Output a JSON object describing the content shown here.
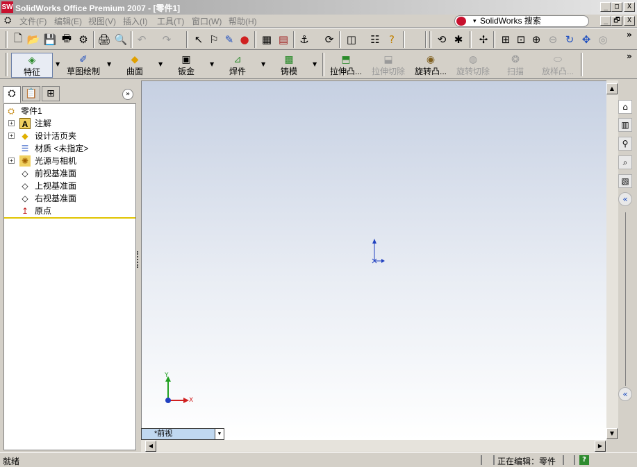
{
  "app": {
    "title": "SolidWorks Office Premium 2007 - [零件1]",
    "logo_text": "SW",
    "accent": "#c8102e"
  },
  "window_buttons": [
    "_",
    "□",
    "X"
  ],
  "doc_buttons": [
    "_",
    "🗗",
    "X"
  ],
  "menu": [
    "文件(F)",
    "编辑(E)",
    "视图(V)",
    "插入(I)",
    "工具(T)",
    "窗口(W)",
    "帮助(H)"
  ],
  "search": {
    "label": "SolidWorks 搜索",
    "dropdown": "▾"
  },
  "toolbar1": {
    "icons": [
      "new-icon",
      "open-icon",
      "save-icon",
      "print-preview-icon",
      "options-icon",
      "print-icon",
      "preview-icon",
      "undo-icon",
      "redo-icon",
      "select-icon",
      "select-other-icon",
      "sketch-icon",
      "traffic-light-icon",
      "grid-icon",
      "brick-icon",
      "instant-icon",
      "rebuild-icon",
      "display-icon",
      "properties-icon",
      "help-icon",
      "rotate-icon",
      "snap-icon",
      "pan-icon",
      "zoom-fit-icon",
      "zoom-area-icon",
      "zoom-in-icon",
      "zoom-out-icon",
      "rotate-view-icon",
      "move-view-icon",
      "roll-icon"
    ],
    "glyphs": [
      "🗋",
      "📂",
      "💾",
      "🖶",
      "⚙",
      "🖨",
      "🔍",
      "↶",
      "↷",
      "↖",
      "⚐",
      "✎",
      "●",
      "▦",
      "▤",
      "⚓",
      "⟳",
      "◫",
      "☷",
      "?",
      "⟲",
      "✱",
      "✢",
      "⊞",
      "⊡",
      "⊕",
      "⊖",
      "↻",
      "✥",
      "◎"
    ]
  },
  "command_manager": [
    {
      "label": "特征",
      "glyph": "◈",
      "state": "selected"
    },
    {
      "label": "草图绘制",
      "glyph": "✐",
      "state": "enabled"
    },
    {
      "label": "曲面",
      "glyph": "◆",
      "state": "enabled"
    },
    {
      "label": "钣金",
      "glyph": "▣",
      "state": "enabled"
    },
    {
      "label": "焊件",
      "glyph": "⊿",
      "state": "enabled"
    },
    {
      "label": "铸模",
      "glyph": "▩",
      "state": "enabled"
    },
    {
      "label": "拉伸凸...",
      "glyph": "⬒",
      "state": "enabled"
    },
    {
      "label": "拉伸切除",
      "glyph": "⬓",
      "state": "disabled"
    },
    {
      "label": "旋转凸...",
      "glyph": "◉",
      "state": "enabled"
    },
    {
      "label": "旋转切除",
      "glyph": "◍",
      "state": "disabled"
    },
    {
      "label": "扫描",
      "glyph": "❂",
      "state": "disabled"
    },
    {
      "label": "放样凸...",
      "glyph": "⬭",
      "state": "disabled"
    }
  ],
  "more_chevron": "»",
  "panel_tabs": [
    "feature-manager-icon",
    "property-manager-icon",
    "config-manager-icon"
  ],
  "panel_tab_glyphs": [
    "⛭",
    "📋",
    "⊞"
  ],
  "panel_collapse": "»",
  "tree": {
    "root": "零件1",
    "items": [
      {
        "label": "注解",
        "glyph": "A",
        "expand": "+"
      },
      {
        "label": "设计活页夹",
        "glyph": "◆",
        "expand": "+"
      },
      {
        "label": "材质 <未指定>",
        "glyph": "☰",
        "expand": ""
      },
      {
        "label": "光源与相机",
        "glyph": "✺",
        "expand": "+"
      },
      {
        "label": "前视基准面",
        "glyph": "◇",
        "expand": ""
      },
      {
        "label": "上视基准面",
        "glyph": "◇",
        "expand": ""
      },
      {
        "label": "右视基准面",
        "glyph": "◇",
        "expand": ""
      },
      {
        "label": "原点",
        "glyph": "↥",
        "expand": ""
      }
    ]
  },
  "viewport": {
    "triad_x": "X",
    "triad_y": "Y",
    "view_name": "*前视"
  },
  "task_pane": {
    "icons": [
      "home-icon",
      "library-icon",
      "explorer-icon",
      "search-icon",
      "palette-icon",
      "collapse-icon"
    ],
    "glyphs": [
      "⌂",
      "▥",
      "⚲",
      "⌕",
      "▧",
      "«"
    ],
    "bottom": "«"
  },
  "status": {
    "left": "就绪",
    "right": "正在编辑：零件",
    "help": "?"
  }
}
